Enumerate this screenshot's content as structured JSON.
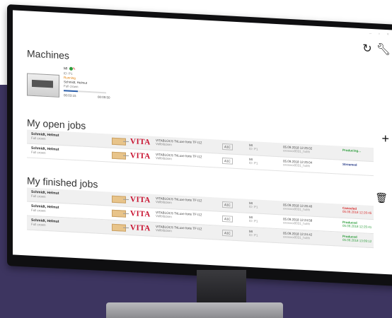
{
  "window": {
    "controls": "– ▫ ×"
  },
  "toolbar": {
    "refresh_icon": "refresh-icon",
    "settings_icon": "wrench-icon"
  },
  "machines": {
    "title": "Machines",
    "card": {
      "name": "MI",
      "id": "ID: P1",
      "status": "Running",
      "user": "Schmidt, Helmut",
      "restoration": "Full crown",
      "elapsed": "00:03:15",
      "total": "00:09:50",
      "progress": 0.33
    }
  },
  "open_jobs": {
    "title": "My open jobs",
    "rows": [
      {
        "user": "Schmidt, Helmut",
        "restoration": "Full crown",
        "brand": "VITA",
        "material": "VITABLOCS TriLuxe forte TF I12",
        "material_sub": "Vollblöcken",
        "shade": "A1C",
        "machine": "MI",
        "machine_id": "ID: P1",
        "date": "05.09.2018 12:25:02",
        "job_id": "xxxxxxx0031_hxhh",
        "status": "Producing...",
        "status_time": "",
        "status_class": "st-green"
      },
      {
        "user": "Schmidt, Helmut",
        "restoration": "Full crown",
        "brand": "VITA",
        "material": "VITABLOCS TriLuxe forte TF I12",
        "material_sub": "Vollblöcken",
        "shade": "A1C",
        "machine": "MI",
        "machine_id": "ID: P1",
        "date": "05.09.2018 12:25:04",
        "job_id": "xxxxxxx0031_hxhh",
        "status": "Streamed",
        "status_time": "",
        "status_class": "st-blue"
      }
    ]
  },
  "finished_jobs": {
    "title": "My finished jobs",
    "rows": [
      {
        "user": "Schmidt, Helmut",
        "restoration": "Full crown",
        "brand": "VITA",
        "material": "VITABLOCS TriLuxe forte TF I12",
        "material_sub": "Vollblöcken",
        "shade": "A1C",
        "machine": "MI",
        "machine_id": "ID: P1",
        "date": "05.09.2018 12:26:40",
        "job_id": "xxxxxxx0031_hxhh",
        "status": "Canceled",
        "status_time": "05.09.2018 12:26:45",
        "status_class": "st-red"
      },
      {
        "user": "Schmidt, Helmut",
        "restoration": "Full crown",
        "brand": "VITA",
        "material": "VITABLOCS TriLuxe forte TF I12",
        "material_sub": "Vollblöcken",
        "shade": "A1C",
        "machine": "MI",
        "machine_id": "ID: P1",
        "date": "05.09.2018 12:24:58",
        "job_id": "xxxxxxx0031_hxhh",
        "status": "Produced",
        "status_time": "05.09.2018 12:25:41",
        "status_class": "st-green"
      },
      {
        "user": "Schmidt, Helmut",
        "restoration": "Full crown",
        "brand": "VITA",
        "material": "VITABLOCS TriLuxe forte TF I12",
        "material_sub": "Vollblöcken",
        "shade": "A1C",
        "machine": "MI",
        "machine_id": "ID: P1",
        "date": "05.09.2018 12:24:42",
        "job_id": "xxxxxxx0031_hxhh",
        "status": "Produced",
        "status_time": "05.09.2018 13:09:12",
        "status_class": "st-green"
      }
    ]
  },
  "actions": {
    "add_icon": "plus-icon",
    "delete_icon": "trash-icon"
  }
}
